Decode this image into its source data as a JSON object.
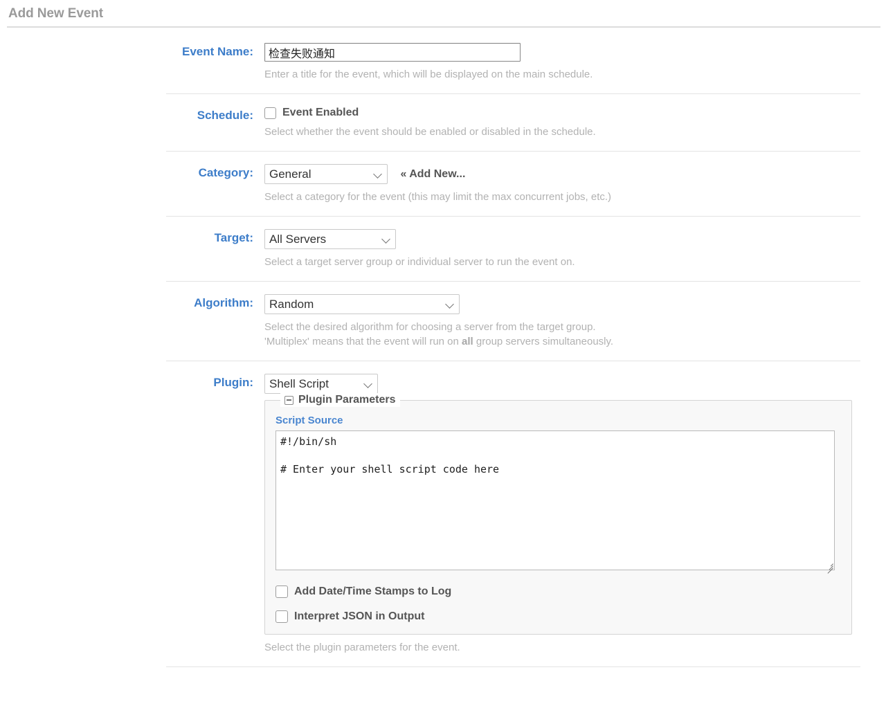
{
  "header": {
    "title": "Add New Event"
  },
  "form": {
    "event_name": {
      "label": "Event Name:",
      "value": "检查失败通知",
      "placeholder": "",
      "caption": "Enter a title for the event, which will be displayed on the main schedule."
    },
    "schedule": {
      "label": "Schedule:",
      "checkbox_label": "Event Enabled",
      "checked": false,
      "caption": "Select whether the event should be enabled or disabled in the schedule."
    },
    "category": {
      "label": "Category:",
      "value": "General",
      "add_new_label": "« Add New...",
      "caption": "Select a category for the event (this may limit the max concurrent jobs, etc.)"
    },
    "target": {
      "label": "Target:",
      "value": "All Servers",
      "caption": "Select a target server group or individual server to run the event on."
    },
    "algorithm": {
      "label": "Algorithm:",
      "value": "Random",
      "caption_line1": "Select the desired algorithm for choosing a server from the target group.",
      "caption_line2_pre": "'Multiplex' means that the event will run on ",
      "caption_line2_bold": "all",
      "caption_line2_post": " group servers simultaneously."
    },
    "plugin": {
      "label": "Plugin:",
      "value": "Shell Script",
      "caption": "Select the plugin parameters for the event.",
      "parameters": {
        "legend": "Plugin Parameters",
        "collapse_icon": "minus-box-icon",
        "script_source_label": "Script Source",
        "script_source_value": "#!/bin/sh\n\n# Enter your shell script code here\n",
        "checkbox_datetime_label": "Add Date/Time Stamps to Log",
        "checkbox_datetime_checked": false,
        "checkbox_json_label": "Interpret JSON in Output",
        "checkbox_json_checked": false
      }
    }
  },
  "colors": {
    "label_blue": "#3d7dc9",
    "sub_label_blue": "#4a86d0",
    "caption_gray": "#b2b2b2",
    "title_gray": "#9a9a9a",
    "fieldset_bg": "#f8f8f8"
  }
}
